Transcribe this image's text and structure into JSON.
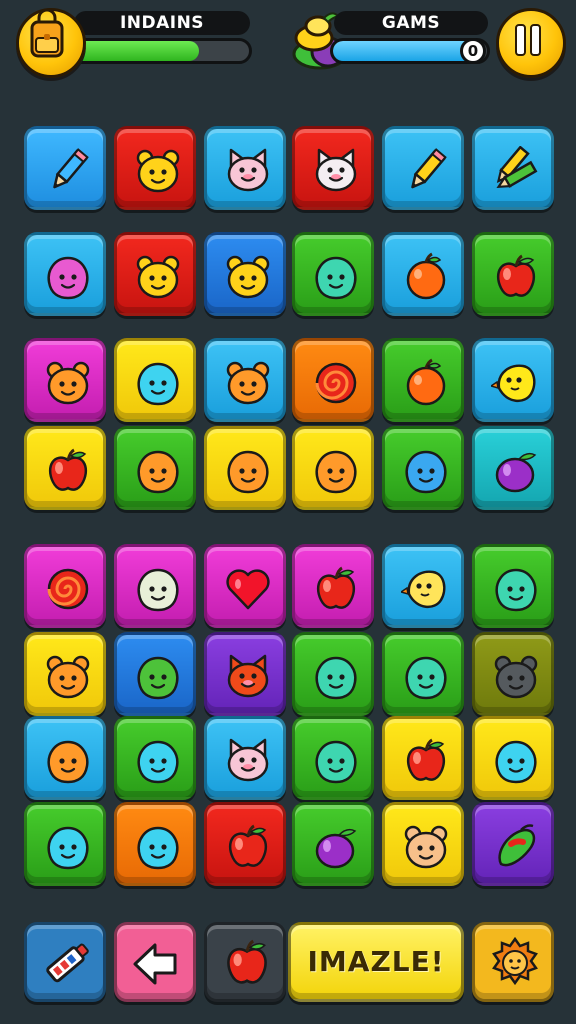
{
  "hud": {
    "level_label": "INDAINS",
    "level_progress": 0.72,
    "games_label": "GAMS",
    "games_progress": 0.95,
    "games_count": "0",
    "left_button_icon": "backpack-icon",
    "pause_button_icon": "pause-icon",
    "fruit_icon": "fruit-stack-icon"
  },
  "colors": {
    "background": "#263238",
    "level_bar": "#2fb51f",
    "games_bar": "#1aa4e6",
    "hud_button": "#ffc40a"
  },
  "board": {
    "columns": 6,
    "tiles": [
      [
        "blue-light",
        "pencil"
      ],
      [
        "red",
        "bear-yellow"
      ],
      [
        "sky",
        "cat-pink"
      ],
      [
        "red",
        "cat-white"
      ],
      [
        "sky",
        "pencil-yellow"
      ],
      [
        "sky",
        "pencils"
      ],
      [
        "sky",
        "blob-pink"
      ],
      [
        "red",
        "bear-yellow"
      ],
      [
        "blue",
        "bear-yellow"
      ],
      [
        "green",
        "blob-teal"
      ],
      [
        "sky",
        "orange"
      ],
      [
        "green",
        "apple"
      ],
      [
        "magenta",
        "bear-orange"
      ],
      [
        "yellow",
        "blob-cyan"
      ],
      [
        "sky",
        "bear-orange"
      ],
      [
        "orange",
        "swirl"
      ],
      [
        "green",
        "orange"
      ],
      [
        "sky",
        "bird-yellow"
      ],
      [
        "yellow",
        "apple"
      ],
      [
        "green",
        "blob-orange"
      ],
      [
        "yellow",
        "blob-orange"
      ],
      [
        "yellow",
        "blob-orange"
      ],
      [
        "green",
        "blob-blue"
      ],
      [
        "teal",
        "plum"
      ],
      [
        "magenta",
        "swirl"
      ],
      [
        "magenta",
        "blob-white"
      ],
      [
        "magenta",
        "heart"
      ],
      [
        "magenta",
        "apple"
      ],
      [
        "sky",
        "bird-lemon"
      ],
      [
        "green",
        "blob-teal"
      ],
      [
        "yellow",
        "bear-orange"
      ],
      [
        "blue",
        "blob-green"
      ],
      [
        "purple",
        "cat-red"
      ],
      [
        "green",
        "blob-teal"
      ],
      [
        "green",
        "blob-teal"
      ],
      [
        "olive",
        "bear-gray"
      ],
      [
        "sky",
        "blob-orange"
      ],
      [
        "green",
        "blob-cyan"
      ],
      [
        "sky",
        "cat-pink"
      ],
      [
        "green",
        "blob-teal"
      ],
      [
        "yellow",
        "apple"
      ],
      [
        "yellow",
        "blob-cyan"
      ],
      [
        "green",
        "blob-cyan"
      ],
      [
        "orange",
        "blob-cyan"
      ],
      [
        "red",
        "apple"
      ],
      [
        "green",
        "plum"
      ],
      [
        "yellow",
        "bear-tan"
      ],
      [
        "purple",
        "pepper"
      ]
    ]
  },
  "bottom_bar": {
    "toolbox_icon": "paint-tube-icon",
    "back_icon": "left-arrow-icon",
    "target_icon": "apple-icon",
    "puzzle_label": "IMAZLE!",
    "bonus_icon": "lion-icon"
  }
}
